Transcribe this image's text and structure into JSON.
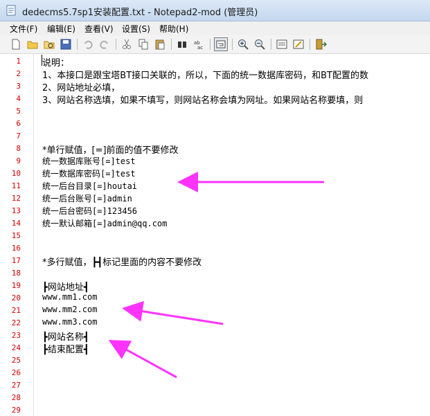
{
  "window": {
    "title": "dedecms5.7sp1安装配置.txt - Notepad2-mod (管理员)",
    "app_icon": "notepad-icon"
  },
  "menu": [
    "文件(F)",
    "编辑(E)",
    "查看(V)",
    "设置(S)",
    "帮助(H)"
  ],
  "toolbar": [
    "new-file-icon",
    "open-folder-icon",
    "browse-icon",
    "save-icon",
    "undo-icon",
    "redo-icon",
    "cut-icon",
    "copy-icon",
    "paste-icon",
    "find-icon",
    "replace-icon",
    "word-wrap-icon",
    "zoom-in-icon",
    "zoom-out-icon",
    "scheme-icon",
    "customize-scheme-icon",
    "exit-icon"
  ],
  "lines": [
    {
      "n": "1",
      "text": "说明："
    },
    {
      "n": "2",
      "text": "1、本接口是跟宝塔BT接口关联的，所以，下面的统一数据库密码，和BT配置的数"
    },
    {
      "n": "3",
      "text": "2、网站地址必填，"
    },
    {
      "n": "4",
      "text": "3、网站名称选填，如果不填写，则网站名称会填为网址。如果网站名称要填，则"
    },
    {
      "n": "5",
      "text": ""
    },
    {
      "n": "6",
      "text": ""
    },
    {
      "n": "7",
      "text": ""
    },
    {
      "n": "8",
      "text": "*单行赋值，[=]前面的值不要修改"
    },
    {
      "n": "9",
      "text": "统一数据库账号[=]test"
    },
    {
      "n": "10",
      "text": "统一数据库密码[=]test"
    },
    {
      "n": "11",
      "text": "统一后台目录[=]houtai"
    },
    {
      "n": "12",
      "text": "统一后台账号[=]admin"
    },
    {
      "n": "13",
      "text": "统一后台密码[=]123456"
    },
    {
      "n": "14",
      "text": "统一默认邮箱[=]admin@qq.com"
    },
    {
      "n": "15",
      "text": ""
    },
    {
      "n": "16",
      "text": ""
    },
    {
      "n": "17",
      "text": "*多行赋值，┣┫标记里面的内容不要修改"
    },
    {
      "n": "18",
      "text": ""
    },
    {
      "n": "19",
      "text": "┣网站地址┫"
    },
    {
      "n": "20",
      "text": "www.mm1.com"
    },
    {
      "n": "21",
      "text": "www.mm2.com"
    },
    {
      "n": "22",
      "text": "www.mm3.com"
    },
    {
      "n": "23",
      "text": "┣网站名称┫"
    },
    {
      "n": "24",
      "text": "┣结束配置┫"
    },
    {
      "n": "25",
      "text": ""
    },
    {
      "n": "26",
      "text": ""
    },
    {
      "n": "27",
      "text": ""
    },
    {
      "n": "28",
      "text": ""
    },
    {
      "n": "29",
      "text": ""
    }
  ],
  "annotation_color": "#ff33ff",
  "gutter_number_color": "#d00000"
}
